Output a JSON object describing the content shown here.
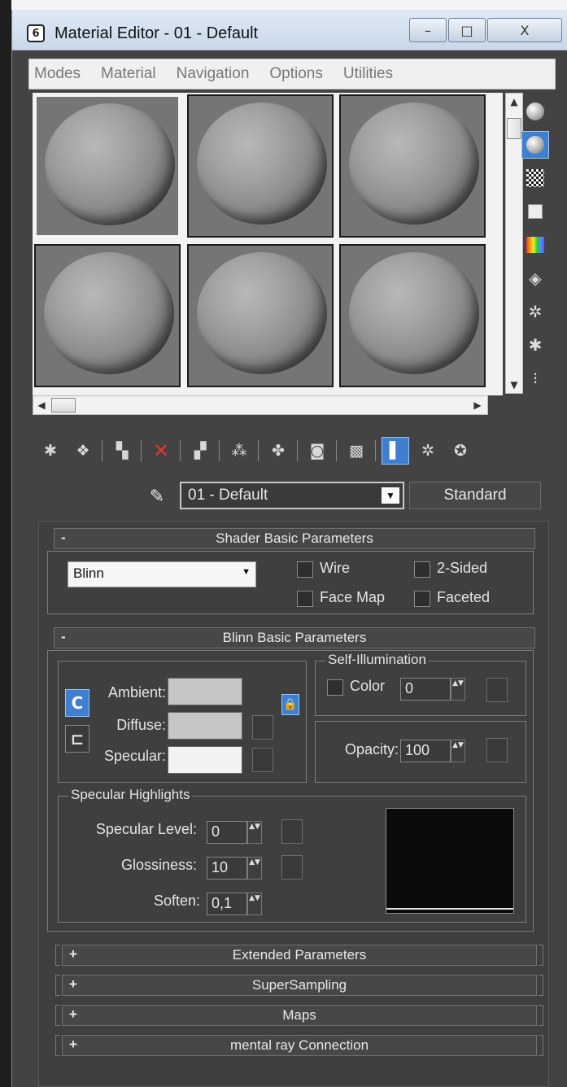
{
  "window": {
    "title": "Material Editor - 01 - Default",
    "app_icon_glyph": "6",
    "controls": {
      "minimize": "–",
      "maximize": "□",
      "close": "X"
    }
  },
  "menu": [
    "Modes",
    "Material",
    "Navigation",
    "Options",
    "Utilities"
  ],
  "slots": {
    "count": 6,
    "active_index": 0
  },
  "side_tools": [
    {
      "name": "sample-type-sphere-icon",
      "kind": "sphere",
      "active": false
    },
    {
      "name": "backlight-icon",
      "kind": "sphere",
      "active": true
    },
    {
      "name": "background-checker-icon",
      "kind": "checker",
      "active": false
    },
    {
      "name": "sample-uv-tiling-icon",
      "kind": "box",
      "active": false
    },
    {
      "name": "video-color-check-icon",
      "kind": "rainbow",
      "active": false
    },
    {
      "name": "make-preview-icon",
      "kind": "glyph",
      "glyph": "◈",
      "active": false
    },
    {
      "name": "options-icon",
      "kind": "glyph",
      "glyph": "✲",
      "active": false
    },
    {
      "name": "select-by-material-icon",
      "kind": "glyph",
      "glyph": "✱",
      "active": false
    },
    {
      "name": "material-map-navigator-icon",
      "kind": "glyph",
      "glyph": "⁝",
      "active": false
    }
  ],
  "toolbar": [
    {
      "name": "get-material-icon",
      "glyph": "✱"
    },
    {
      "name": "put-to-scene-icon",
      "glyph": "❖"
    },
    {
      "sep": true
    },
    {
      "name": "assign-material-icon",
      "glyph": "▚"
    },
    {
      "sep": true
    },
    {
      "name": "reset-map-icon",
      "glyph": "✕",
      "red": true
    },
    {
      "sep": true
    },
    {
      "name": "copy-material-icon",
      "glyph": "▞"
    },
    {
      "sep": true
    },
    {
      "name": "make-unique-icon",
      "glyph": "⁂"
    },
    {
      "sep": true
    },
    {
      "name": "put-to-library-icon",
      "glyph": "✤"
    },
    {
      "sep": true
    },
    {
      "name": "material-id-channel-icon",
      "glyph": "◙"
    },
    {
      "sep": true
    },
    {
      "name": "show-map-in-viewport-icon",
      "glyph": "▩"
    },
    {
      "sep": true
    },
    {
      "name": "show-end-result-icon",
      "glyph": "▌",
      "active": true
    },
    {
      "name": "go-to-parent-icon",
      "glyph": "✲"
    },
    {
      "name": "go-forward-to-sibling-icon",
      "glyph": "✪"
    }
  ],
  "material": {
    "name": "01 - Default",
    "type": "Standard"
  },
  "shader_params": {
    "title": "Shader Basic Parameters",
    "collapse_sign": "-",
    "shader": "Blinn",
    "wire_label": "Wire",
    "two_sided_label": "2-Sided",
    "face_map_label": "Face Map",
    "faceted_label": "Faceted"
  },
  "blinn_params": {
    "title": "Blinn Basic Parameters",
    "collapse_sign": "-",
    "ambient_label": "Ambient:",
    "diffuse_label": "Diffuse:",
    "specular_label": "Specular:",
    "ambient_color": "#c6c6c6",
    "diffuse_color": "#c6c6c6",
    "specular_color": "#f2f2f2",
    "lock_glyph": "C",
    "lock2_glyph": "⊏",
    "padlock_glyph": "🔒",
    "self_illum": {
      "title": "Self-Illumination",
      "color_label": "Color",
      "value": "0"
    },
    "opacity": {
      "label": "Opacity:",
      "value": "100"
    },
    "specular_highlights": {
      "title": "Specular Highlights",
      "level_label": "Specular Level:",
      "level_value": "0",
      "gloss_label": "Glossiness:",
      "gloss_value": "10",
      "soften_label": "Soften:",
      "soften_value": "0,1"
    }
  },
  "collapsed_rollouts": [
    {
      "sign": "+",
      "title": "Extended Parameters"
    },
    {
      "sign": "+",
      "title": "SuperSampling"
    },
    {
      "sign": "+",
      "title": "Maps"
    },
    {
      "sign": "+",
      "title": "mental ray Connection"
    }
  ],
  "scroll_glyphs": {
    "up": "▲",
    "down": "▼",
    "left": "◀",
    "right": "▶",
    "dropdown": "▼",
    "spin": "▲▼"
  }
}
